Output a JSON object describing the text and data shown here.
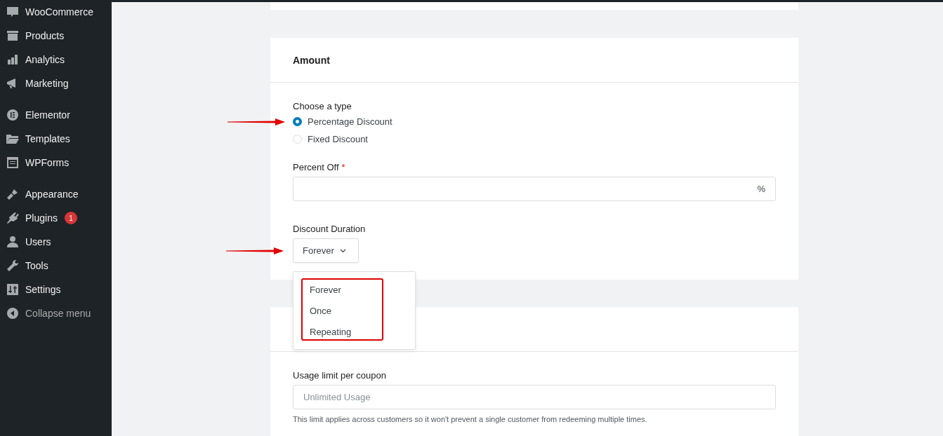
{
  "sidebar": {
    "groups": [
      {
        "items": [
          {
            "label": "WooCommerce"
          },
          {
            "label": "Products"
          },
          {
            "label": "Analytics"
          },
          {
            "label": "Marketing"
          }
        ]
      },
      {
        "items": [
          {
            "label": "Elementor"
          },
          {
            "label": "Templates"
          },
          {
            "label": "WPForms"
          }
        ]
      },
      {
        "items": [
          {
            "label": "Appearance"
          },
          {
            "label": "Plugins",
            "badge": "1"
          },
          {
            "label": "Users"
          },
          {
            "label": "Tools"
          },
          {
            "label": "Settings"
          }
        ]
      }
    ],
    "collapse": "Collapse menu"
  },
  "amount_card": {
    "title": "Amount",
    "type_field": {
      "label": "Choose a type",
      "arrow": true,
      "options": [
        {
          "label": "Percentage Discount",
          "selected": true
        },
        {
          "label": "Fixed Discount",
          "selected": false
        }
      ]
    },
    "percent_field": {
      "label": "Percent Off",
      "required_mark": "*",
      "suffix": "%"
    },
    "duration_field": {
      "label": "Discount Duration",
      "arrow": true,
      "value": "Forever",
      "expanded": true,
      "highlighted": true,
      "options": [
        "Forever",
        "Once",
        "Repeating"
      ]
    }
  },
  "usage_card": {
    "field": {
      "label": "Usage limit per coupon",
      "placeholder": "Unlimited Usage",
      "help": "This limit applies across customers so it won't prevent a single customer from redeeming multiple times."
    }
  }
}
